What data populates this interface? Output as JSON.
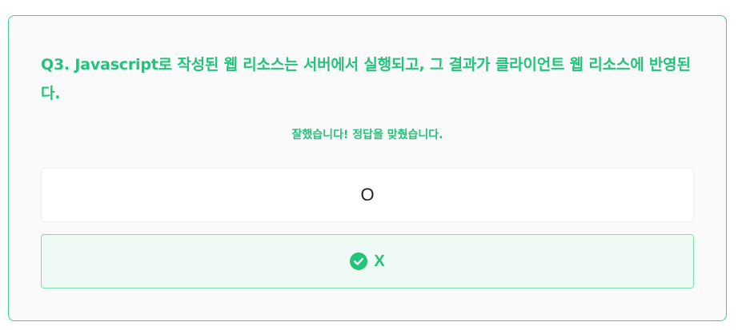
{
  "quiz": {
    "question": "Q3. Javascript로 작성된 웹 리소스는 서버에서 실행되고, 그 결과가 클라이언트 웹 리소스에 반영된다.",
    "feedback": "잘했습니다! 정답을 맞췄습니다.",
    "options": [
      {
        "label": "O",
        "selected": false
      },
      {
        "label": "X",
        "selected": true,
        "icon": "check-circle-icon"
      }
    ]
  },
  "colors": {
    "accent": "#22c37a",
    "border_accent": "#3fcf8e",
    "selected_bg": "#effaf4",
    "card_bg": "#fafafa"
  }
}
